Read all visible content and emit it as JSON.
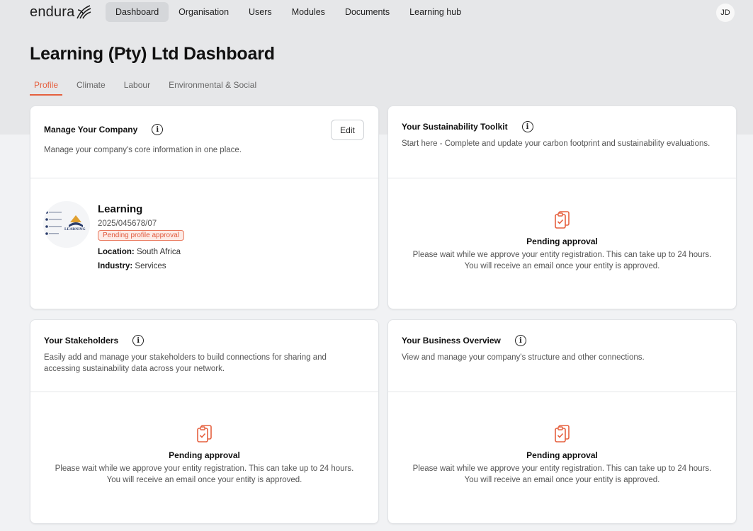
{
  "header": {
    "logo_text": "endura",
    "nav": [
      "Dashboard",
      "Organisation",
      "Users",
      "Modules",
      "Documents",
      "Learning hub"
    ],
    "active_nav": 0,
    "avatar_initials": "JD"
  },
  "page": {
    "title": "Learning (Pty) Ltd Dashboard",
    "tabs": [
      "Profile",
      "Climate",
      "Labour",
      "Environmental & Social"
    ],
    "active_tab": 0
  },
  "colors": {
    "accent": "#e5603f",
    "nav_active_bg": "#d5d7da",
    "band_bg": "#e6e7e9"
  },
  "manage_company": {
    "title": "Manage Your Company",
    "description": "Manage your company's core information in one place.",
    "edit_label": "Edit",
    "company_name": "Learning",
    "registration": "2025/045678/07",
    "status": "Pending profile approval",
    "location_label": "Location:",
    "location": "South Africa",
    "industry_label": "Industry:",
    "industry": "Services",
    "logo_text": "LEARNING"
  },
  "toolkit": {
    "title": "Your Sustainability Toolkit",
    "description": "Start here - Complete and update your carbon footprint and sustainability evaluations.",
    "pending_title": "Pending approval",
    "pending_line1": "Please wait while we approve your entity registration. This can take up to 24 hours.",
    "pending_line2": "You will receive an email once your entity is approved."
  },
  "stakeholders": {
    "title": "Your Stakeholders",
    "description": "Easily add and manage your stakeholders to build connections for sharing and accessing sustainability data across your network.",
    "pending_title": "Pending approval",
    "pending_line1": "Please wait while we approve your entity registration. This can take up to 24 hours.",
    "pending_line2": "You will receive an email once your entity is approved."
  },
  "business_overview": {
    "title": "Your Business Overview",
    "description": "View and manage your company's structure and other connections.",
    "pending_title": "Pending approval",
    "pending_line1": "Please wait while we approve your entity registration. This can take up to 24 hours.",
    "pending_line2": "You will receive an email once your entity is approved."
  }
}
